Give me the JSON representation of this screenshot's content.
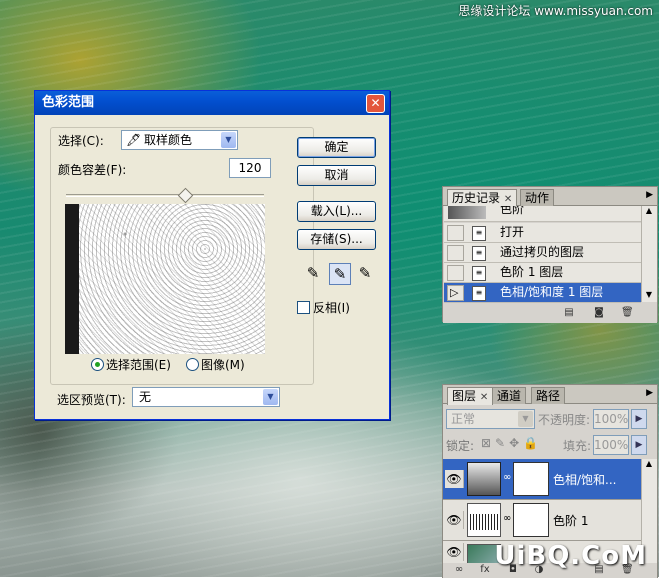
{
  "watermark_top": "思缘设计论坛 www.missyuan.com",
  "watermark_bottom": "UiBQ.CoM",
  "dialog": {
    "title": "色彩范围",
    "select_label": "选择(C):",
    "select_value": "取样颜色",
    "fuzziness_label": "颜色容差(F):",
    "fuzziness_value": "120",
    "fuzziness_fraction": 0.6,
    "radio_selection": "选择范围(E)",
    "radio_image": "图像(M)",
    "preview_label": "选区预览(T):",
    "preview_value": "无",
    "buttons": {
      "ok": "确定",
      "cancel": "取消",
      "load": "载入(L)...",
      "save": "存储(S)..."
    },
    "invert_label": "反相(I)"
  },
  "history": {
    "tabs": [
      "历史记录",
      "动作"
    ],
    "top_partial": "色阶",
    "items": [
      {
        "label": "打开",
        "selected": false
      },
      {
        "label": "通过拷贝的图层",
        "selected": false
      },
      {
        "label": "色阶 1 图层",
        "selected": false
      },
      {
        "label": "色相/饱和度 1 图层",
        "selected": true
      }
    ]
  },
  "layers": {
    "tabs": [
      "图层",
      "通道",
      "路径"
    ],
    "blend_mode": "正常",
    "opacity_label": "不透明度:",
    "opacity_value": "100%",
    "lock_label": "锁定:",
    "fill_label": "填充:",
    "fill_value": "100%",
    "items": [
      {
        "name": "色相/饱和...",
        "selected": true
      },
      {
        "name": "色阶 1",
        "selected": false
      },
      {
        "name": "",
        "selected": false
      }
    ]
  },
  "colors": {
    "selection": "#3365c2",
    "title_bar": "#0350d0"
  }
}
